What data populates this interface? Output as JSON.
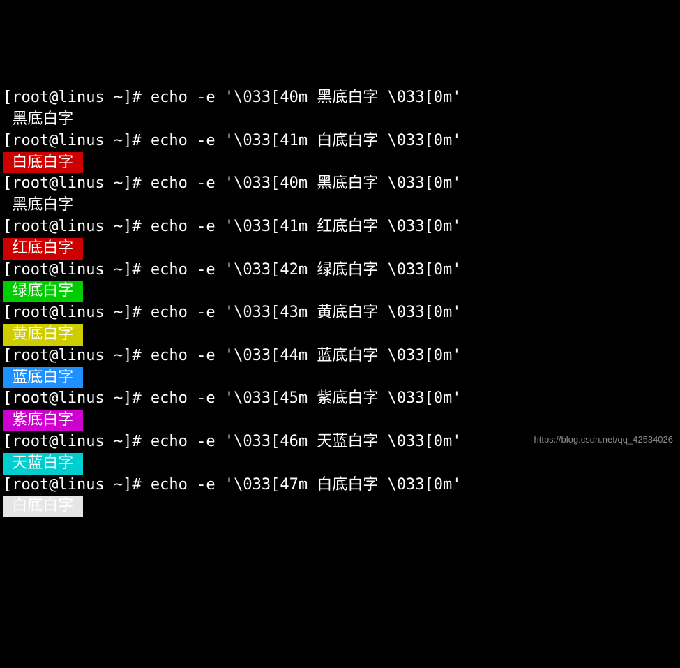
{
  "prompt": "[root@linus ~]# ",
  "watermark": "https://blog.csdn.net/qq_42534026",
  "lines": [
    {
      "cmd": "echo -e '\\033[40m 黑底白字 \\033[0m'",
      "out_class": "bg-black",
      "out_text": " 黑底白字 "
    },
    {
      "cmd": "echo -e '\\033[41m 白底白字 \\033[0m'",
      "out_class": "bg-red",
      "out_text": " 白底白字 "
    },
    {
      "cmd": "echo -e '\\033[40m 黑底白字 \\033[0m'",
      "out_class": "bg-black",
      "out_text": " 黑底白字 "
    },
    {
      "cmd": "echo -e '\\033[41m 红底白字 \\033[0m'",
      "out_class": "bg-red",
      "out_text": " 红底白字 "
    },
    {
      "cmd": "echo -e '\\033[42m 绿底白字 \\033[0m'",
      "out_class": "bg-green",
      "out_text": " 绿底白字 "
    },
    {
      "cmd": "echo -e '\\033[43m 黄底白字 \\033[0m'",
      "out_class": "bg-yellow",
      "out_text": " 黄底白字 "
    },
    {
      "cmd": "echo -e '\\033[44m 蓝底白字 \\033[0m'",
      "out_class": "bg-blue",
      "out_text": " 蓝底白字 "
    },
    {
      "cmd": "echo -e '\\033[45m 紫底白字 \\033[0m'",
      "out_class": "bg-magenta",
      "out_text": " 紫底白字 "
    },
    {
      "cmd": "echo -e '\\033[46m 天蓝白字 \\033[0m'",
      "out_class": "bg-cyan",
      "out_text": " 天蓝白字 "
    },
    {
      "cmd": "echo -e '\\033[47m 白底白字 \\033[0m'",
      "out_class": "bg-white",
      "out_text": " 白底白字 "
    }
  ]
}
